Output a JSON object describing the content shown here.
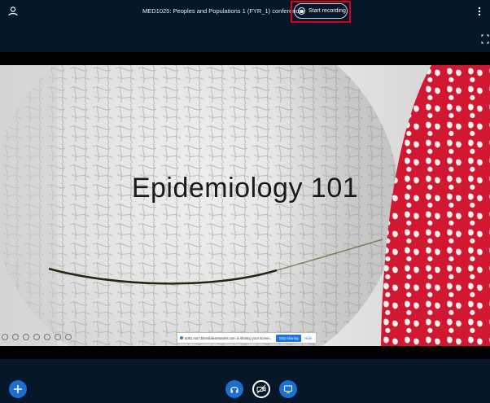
{
  "header": {
    "title": "MED1025: Peoples and Populations 1 (FYR_1) conference",
    "record_label": "Start recording"
  },
  "slide": {
    "title": "Epidemiology 101"
  },
  "screen_share": {
    "message": "a081.rsa7.bbmobilenetworks.com is sharing your screen.",
    "stop_label": "Stop sharing",
    "hide_label": "Hide"
  },
  "colors": {
    "background": "#06172a",
    "accent": "#1b6fd1",
    "highlight": "#e0001a",
    "slide_accent": "#c8102e"
  },
  "icons": {
    "user": "user-icon",
    "record": "record-icon",
    "more": "more-vertical-icon",
    "fullscreen": "fullscreen-icon",
    "actions": "plus-icon",
    "audio": "headphones-icon",
    "video": "video-off-icon",
    "screenshare": "screen-share-icon"
  }
}
